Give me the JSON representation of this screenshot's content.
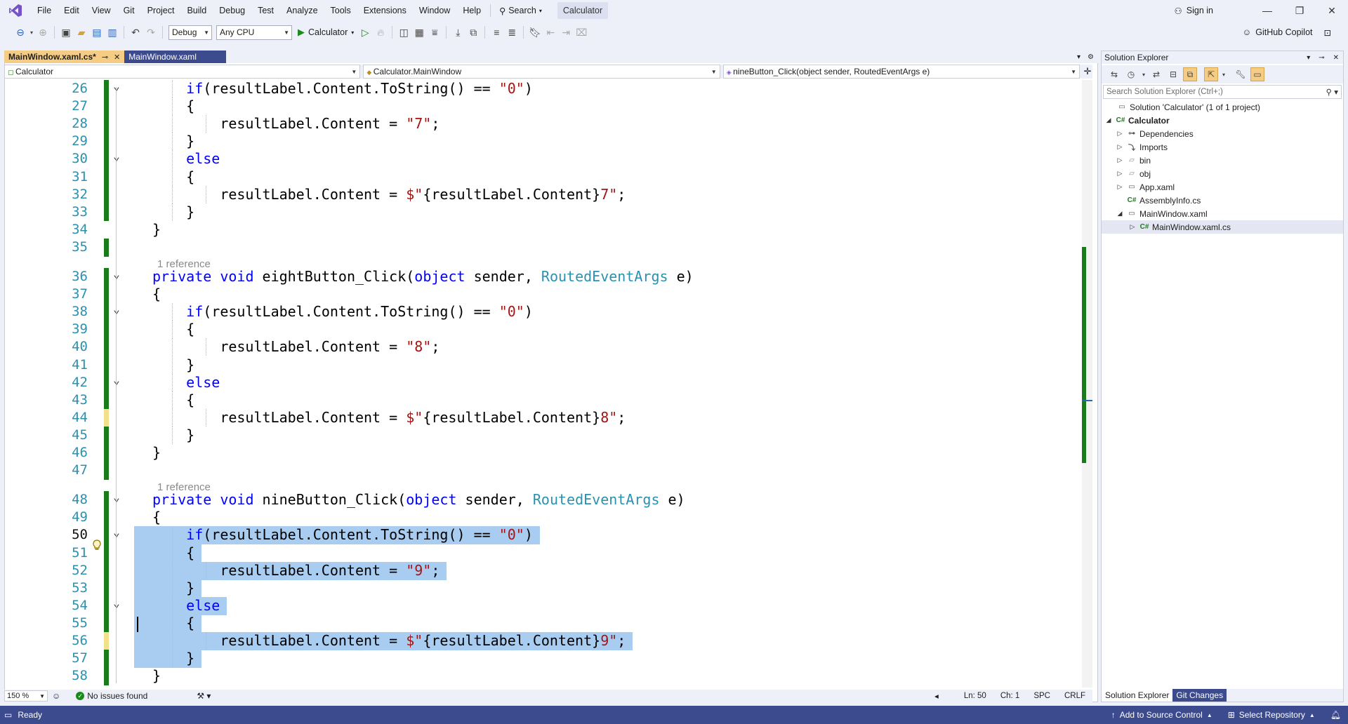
{
  "app": {
    "menu": [
      "File",
      "Edit",
      "View",
      "Git",
      "Project",
      "Build",
      "Debug",
      "Test",
      "Analyze",
      "Tools",
      "Extensions",
      "Window",
      "Help"
    ],
    "search_label": "Search",
    "solution_name": "Calculator",
    "sign_in": "Sign in"
  },
  "toolbar": {
    "config": "Debug",
    "platform": "Any CPU",
    "run_target": "Calculator",
    "copilot": "GitHub Copilot"
  },
  "tabs": [
    {
      "label": "MainWindow.xaml.cs*",
      "active": true
    },
    {
      "label": "MainWindow.xaml",
      "active": false
    }
  ],
  "navbar": {
    "project": "Calculator",
    "type": "Calculator.MainWindow",
    "member": "nineButton_Click(object sender, RoutedEventArgs e)"
  },
  "editor": {
    "current_line": 50,
    "zoom": "150 %",
    "issues": "No issues found",
    "position_line": "Ln: 50",
    "position_char": "Ch: 1",
    "whitespace": "SPC",
    "line_ending": "CRLF",
    "reference_hint": "1 reference",
    "lines": [
      {
        "n": 26,
        "indent": 2,
        "segs": [
          [
            "kw",
            "if"
          ],
          [
            "",
            "(resultLabel.Content.ToString() == "
          ],
          [
            "st",
            "\"0\""
          ],
          [
            "",
            ")"
          ]
        ]
      },
      {
        "n": 27,
        "indent": 2,
        "segs": [
          [
            "",
            "{"
          ]
        ]
      },
      {
        "n": 28,
        "indent": 3,
        "segs": [
          [
            "",
            "resultLabel.Content = "
          ],
          [
            "st",
            "\"7\""
          ],
          [
            "",
            ";"
          ]
        ]
      },
      {
        "n": 29,
        "indent": 2,
        "segs": [
          [
            "",
            "}"
          ]
        ]
      },
      {
        "n": 30,
        "indent": 2,
        "segs": [
          [
            "kw",
            "else"
          ]
        ]
      },
      {
        "n": 31,
        "indent": 2,
        "segs": [
          [
            "",
            "{"
          ]
        ]
      },
      {
        "n": 32,
        "indent": 3,
        "segs": [
          [
            "",
            "resultLabel.Content = "
          ],
          [
            "st",
            "$\""
          ],
          [
            "",
            "{resultLabel.Content}"
          ],
          [
            "st",
            "7\""
          ],
          [
            "",
            ";"
          ]
        ]
      },
      {
        "n": 33,
        "indent": 2,
        "segs": [
          [
            "",
            "}"
          ]
        ]
      },
      {
        "n": 34,
        "indent": 1,
        "segs": [
          [
            "",
            "}"
          ]
        ]
      },
      {
        "n": 35,
        "indent": 0,
        "segs": []
      },
      {
        "n": 36,
        "indent": 1,
        "segs": [
          [
            "kw",
            "private"
          ],
          [
            "",
            " "
          ],
          [
            "kw",
            "void"
          ],
          [
            "",
            " eightButton_Click("
          ],
          [
            "kw",
            "object"
          ],
          [
            "",
            " sender, "
          ],
          [
            "ty",
            "RoutedEventArgs"
          ],
          [
            "",
            " e)"
          ]
        ]
      },
      {
        "n": 37,
        "indent": 1,
        "segs": [
          [
            "",
            "{"
          ]
        ]
      },
      {
        "n": 38,
        "indent": 2,
        "segs": [
          [
            "kw",
            "if"
          ],
          [
            "",
            "(resultLabel.Content.ToString() == "
          ],
          [
            "st",
            "\"0\""
          ],
          [
            "",
            ")"
          ]
        ]
      },
      {
        "n": 39,
        "indent": 2,
        "segs": [
          [
            "",
            "{"
          ]
        ]
      },
      {
        "n": 40,
        "indent": 3,
        "segs": [
          [
            "",
            "resultLabel.Content = "
          ],
          [
            "st",
            "\"8\""
          ],
          [
            "",
            ";"
          ]
        ]
      },
      {
        "n": 41,
        "indent": 2,
        "segs": [
          [
            "",
            "}"
          ]
        ]
      },
      {
        "n": 42,
        "indent": 2,
        "segs": [
          [
            "kw",
            "else"
          ]
        ]
      },
      {
        "n": 43,
        "indent": 2,
        "segs": [
          [
            "",
            "{"
          ]
        ]
      },
      {
        "n": 44,
        "indent": 3,
        "segs": [
          [
            "",
            "resultLabel.Content = "
          ],
          [
            "st",
            "$\""
          ],
          [
            "",
            "{resultLabel.Content}"
          ],
          [
            "st",
            "8\""
          ],
          [
            "",
            ";"
          ]
        ]
      },
      {
        "n": 45,
        "indent": 2,
        "segs": [
          [
            "",
            "}"
          ]
        ]
      },
      {
        "n": 46,
        "indent": 1,
        "segs": [
          [
            "",
            "}"
          ]
        ]
      },
      {
        "n": 47,
        "indent": 0,
        "segs": []
      },
      {
        "n": 48,
        "indent": 1,
        "segs": [
          [
            "kw",
            "private"
          ],
          [
            "",
            " "
          ],
          [
            "kw",
            "void"
          ],
          [
            "",
            " nineButton_Click("
          ],
          [
            "kw",
            "object"
          ],
          [
            "",
            " sender, "
          ],
          [
            "ty",
            "RoutedEventArgs"
          ],
          [
            "",
            " e)"
          ]
        ]
      },
      {
        "n": 49,
        "indent": 1,
        "segs": [
          [
            "",
            "{"
          ]
        ]
      },
      {
        "n": 50,
        "indent": 2,
        "segs": [
          [
            "kw",
            "if"
          ],
          [
            "",
            "(resultLabel.Content.ToString() == "
          ],
          [
            "st",
            "\"0\""
          ],
          [
            "",
            ")"
          ]
        ]
      },
      {
        "n": 51,
        "indent": 2,
        "segs": [
          [
            "",
            "{"
          ]
        ]
      },
      {
        "n": 52,
        "indent": 3,
        "segs": [
          [
            "",
            "resultLabel.Content = "
          ],
          [
            "st",
            "\"9\""
          ],
          [
            "",
            ";"
          ]
        ]
      },
      {
        "n": 53,
        "indent": 2,
        "segs": [
          [
            "",
            "}"
          ]
        ]
      },
      {
        "n": 54,
        "indent": 2,
        "segs": [
          [
            "kw",
            "else"
          ]
        ]
      },
      {
        "n": 55,
        "indent": 2,
        "segs": [
          [
            "",
            "{"
          ]
        ]
      },
      {
        "n": 56,
        "indent": 3,
        "segs": [
          [
            "",
            "resultLabel.Content = "
          ],
          [
            "st",
            "$\""
          ],
          [
            "",
            "{resultLabel.Content}"
          ],
          [
            "st",
            "9\""
          ],
          [
            "",
            ";"
          ]
        ]
      },
      {
        "n": 57,
        "indent": 2,
        "segs": [
          [
            "",
            "}"
          ]
        ]
      },
      {
        "n": 58,
        "indent": 1,
        "segs": [
          [
            "",
            "}"
          ]
        ]
      }
    ]
  },
  "solution_explorer": {
    "title": "Solution Explorer",
    "search_placeholder": "Search Solution Explorer (Ctrl+;)",
    "tree": [
      {
        "label": "Solution 'Calculator' (1 of 1 project)",
        "icon": "solution-icon"
      },
      {
        "label": "Calculator",
        "icon": "csharp-project-icon"
      },
      {
        "label": "Dependencies",
        "icon": "dependencies-icon"
      },
      {
        "label": "Imports",
        "icon": "imports-icon"
      },
      {
        "label": "bin",
        "icon": "folder-icon"
      },
      {
        "label": "obj",
        "icon": "folder-icon"
      },
      {
        "label": "App.xaml",
        "icon": "xaml-icon"
      },
      {
        "label": "AssemblyInfo.cs",
        "icon": "csharp-file-icon"
      },
      {
        "label": "MainWindow.xaml",
        "icon": "xaml-icon"
      },
      {
        "label": "MainWindow.xaml.cs",
        "icon": "csharp-file-icon"
      }
    ],
    "tabs": [
      "Solution Explorer",
      "Git Changes"
    ]
  },
  "statusbar": {
    "ready": "Ready",
    "source_control": "Add to Source Control",
    "repository": "Select Repository"
  },
  "colors": {
    "accent": "#3c4a8e",
    "active_tab": "#f5cc84",
    "selection": "#a8cdf0",
    "change_saved": "#1a7b1a",
    "keyword": "#0000ff",
    "type": "#2b91af",
    "string": "#a31515"
  }
}
